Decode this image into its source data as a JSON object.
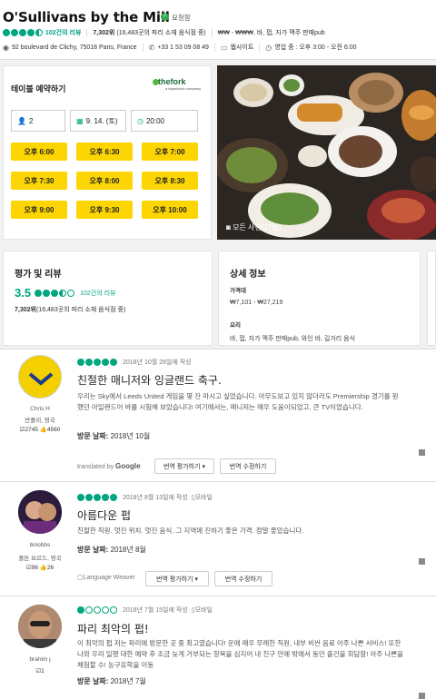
{
  "header": {
    "title": "O'Sullivans by the Mill",
    "claimed": "요청함",
    "review_count": "102건의 리뷰",
    "rank": "7,302위",
    "rank_detail": "(16,483곳의 파리 소재 음식점 중)",
    "price_cuisine": "₩₩ - ₩₩₩, 바, 펍, 자가 맥주 판매pub",
    "address": "92 boulevard de Clichy, 75018 Paris, France",
    "phone": "+33 1 53 09 08 49",
    "website": "웹사이트",
    "hours": "영업 중 : 오후 3:00 - 오전 6:00",
    "rating_bubbles": 4.5
  },
  "reservation": {
    "title": "테이블 예약하기",
    "partner": "thefork",
    "partner_sub": "a tripadvisor company",
    "party": "2",
    "date": "9. 14. (토)",
    "time": "20:00",
    "slots": [
      "오후 6:00",
      "오후 6:30",
      "오후 7:00",
      "오후 7:30",
      "오후 8:00",
      "오후 8:30",
      "오후 9:00",
      "오후 9:30",
      "오후 10:00"
    ]
  },
  "photo": {
    "label": "모든 사진(27장)"
  },
  "ratings": {
    "title": "평가 및 리뷰",
    "score": "3.5",
    "count": "102건의 리뷰",
    "rank_bold": "7,302위",
    "rank_rest": "(16,483곳의 파리 소재 음식점 중)",
    "bubbles": 3.5
  },
  "details": {
    "title": "상세 정보",
    "price_label": "가격대",
    "price_value": "₩7,101 - ₩27,219",
    "cuisine_label": "요리",
    "cuisine_value": "바, 펍, 자가 맥주 판매pub, 와인 바, 길거리 음식"
  },
  "reviews": [
    {
      "user": "Chris H",
      "location": "반플리, 영국",
      "contribs": "2745",
      "helpful": "4560",
      "bubbles": 5,
      "date": "2018년 10월 28일에 작성",
      "mobile": "",
      "title": "친절한 매니저와 잉글랜드 축구.",
      "body": "우리는 Sky에서 Leeds United 게임을 몇 잔 마시고 싶었습니다. 아무도보고 있지 않더라도 Premiership 경기를 원했던 아일랜드어 바를 시험해 보았습니다! 여기에서는, 매니저는 매우 도움이되었고, 큰 TV이었습니다.",
      "visit_label": "방문 날짜:",
      "visit_date": "2018년 10월",
      "translated_by": "translated by",
      "translator": "Google",
      "rate_translation": "번역 평가하기",
      "suggest_edit": "번역 수정하기"
    },
    {
      "user": "lknobbs",
      "location": "폴튼 브르드, 영국",
      "contribs": "96",
      "helpful": "26",
      "bubbles": 5,
      "date": "2018년 8월 13일에 작성",
      "mobile": "모바일",
      "title": "아름다운 펍",
      "body": "친절한 직원. 멋진 위치. 멋진 음식. 그 지역에 진하기 좋은 가격. 정말 좋았습니다.",
      "visit_label": "방문 날짜:",
      "visit_date": "2018년 8월",
      "translator": "Language Weaver",
      "rate_translation": "번역 평가하기",
      "suggest_edit": "번역 수정하기"
    },
    {
      "user": "brahim j",
      "location": "",
      "contribs": "1",
      "helpful": "",
      "bubbles": 1,
      "date": "2018년 7월 15일에 작성",
      "mobile": "모바일",
      "title": "파리 최악의 펍!",
      "body": "이 최악의 펍 저는 파리에 방문한 곳 중 최고였습니다! 운에 매우 무례한 직원, 내부 비싼 음료 아주 나쁜 서비스! 또한 나와 우리 일행 대한 예약 후 조금 늦게 거부되는 항목을 심지어 내 친구 안에 밖에서 동안 출건을 회담함! 아주 나쁜을 체험할 수! 농구유학을 이동",
      "visit_label": "방문 날짜:",
      "visit_date": "2018년 7월"
    }
  ]
}
